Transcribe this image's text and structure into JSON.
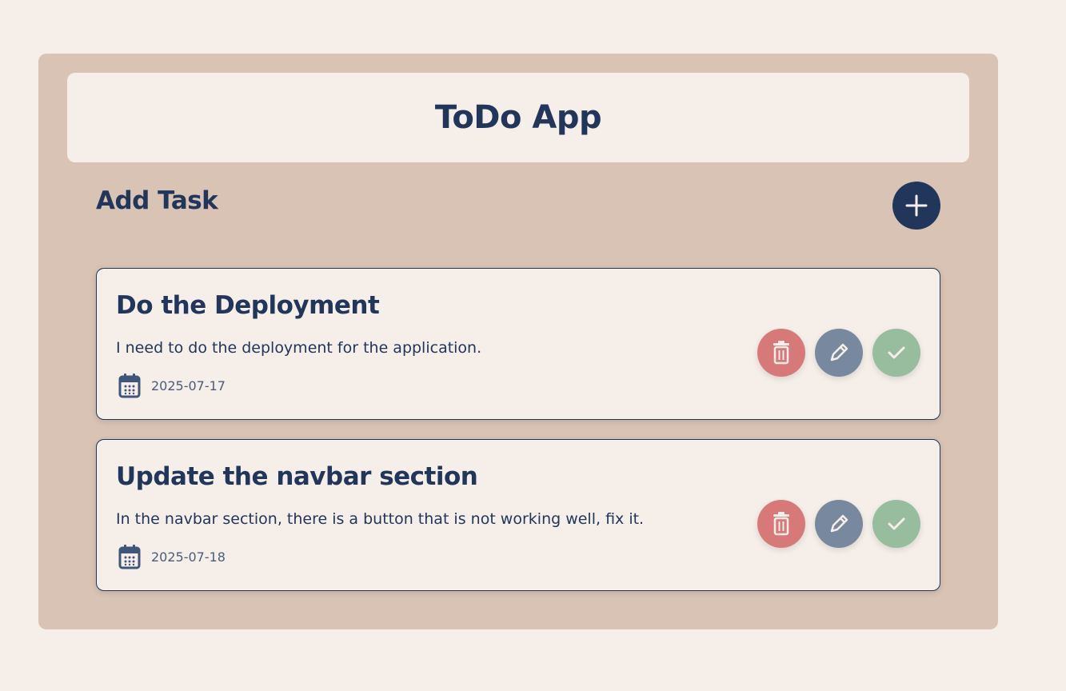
{
  "app": {
    "title": "ToDo App"
  },
  "add_task": {
    "label": "Add Task",
    "button_icon": "plus-icon"
  },
  "tasks": [
    {
      "title": "Do the Deployment",
      "description": "I need to do the deployment for the application.",
      "date": "2025-07-17"
    },
    {
      "title": "Update the navbar section",
      "description": "In the navbar section, there is a button that is not working well, fix it.",
      "date": "2025-07-18"
    }
  ],
  "icons": {
    "date": "calendar-icon",
    "delete": "trash-icon",
    "edit": "pencil-icon",
    "complete": "check-icon"
  },
  "colors": {
    "background": "#f6efe9",
    "panel": "#d8c3b5",
    "primary": "#22355a",
    "delete": "#d87979",
    "edit": "#78889f",
    "complete": "#98bc9e"
  }
}
